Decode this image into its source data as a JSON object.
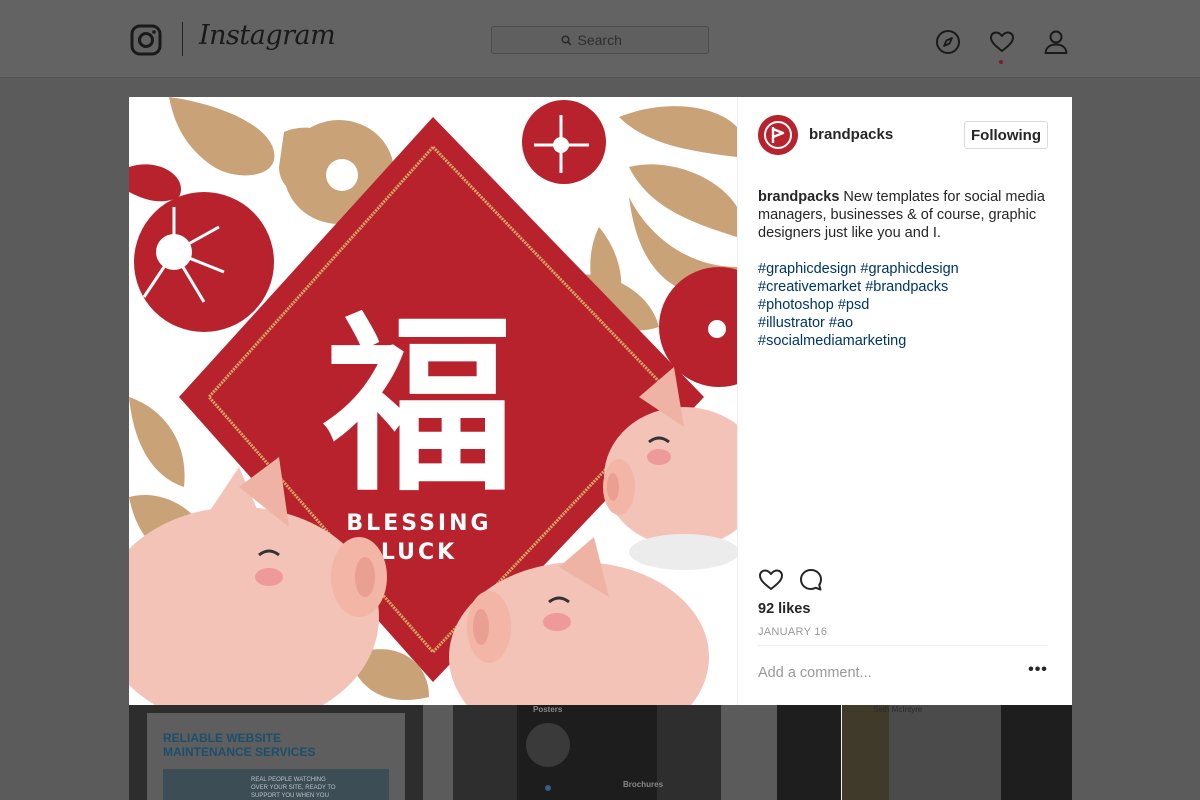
{
  "app": {
    "wordmark": "Instagram",
    "logo_icon": "instagram-camera-icon"
  },
  "search": {
    "placeholder": "Search",
    "icon": "search-icon"
  },
  "nav": {
    "icons": [
      "compass-icon",
      "heart-icon",
      "profile-icon"
    ],
    "has_notification": true
  },
  "post": {
    "image": {
      "headline_line1": "BLESSING",
      "headline_line2": "LUCK",
      "glyph": "福"
    },
    "author": {
      "username": "brandpacks",
      "follow_label": "Following"
    },
    "caption": {
      "author": "brandpacks",
      "text": " New templates for social media managers, businesses & of course, graphic designers just like you and I."
    },
    "hashtag_lines": [
      [
        "#graphicdesign",
        "#graphicdesign"
      ],
      [
        "#creativemarket",
        "#brandpacks"
      ],
      [
        "#photoshop",
        "#psd"
      ],
      [
        "#illustrator",
        "#ao"
      ],
      [
        "#socialmediamarketing"
      ]
    ],
    "likes": "92 likes",
    "date": "JANUARY 16",
    "comment_placeholder": "Add a comment...",
    "more_label": "•••"
  },
  "grid_tiles": {
    "tile1": {
      "title_line1": "RELIABLE WEBSITE",
      "title_line2": "MAINTENANCE SERVICES",
      "blurb": "REAL PEOPLE WATCHING OVER YOUR SITE, READY TO SUPPORT YOU WHEN YOU NEED IT"
    },
    "tile2": {
      "label_top": "Posters",
      "label_bottom": "Brochures"
    },
    "tile3": {
      "name": "Seth McIntyre"
    }
  },
  "colors": {
    "brand_red": "#b8222d",
    "gold": "#c9a278",
    "pig_pink": "#f3c3b7",
    "link_blue": "#003569"
  }
}
